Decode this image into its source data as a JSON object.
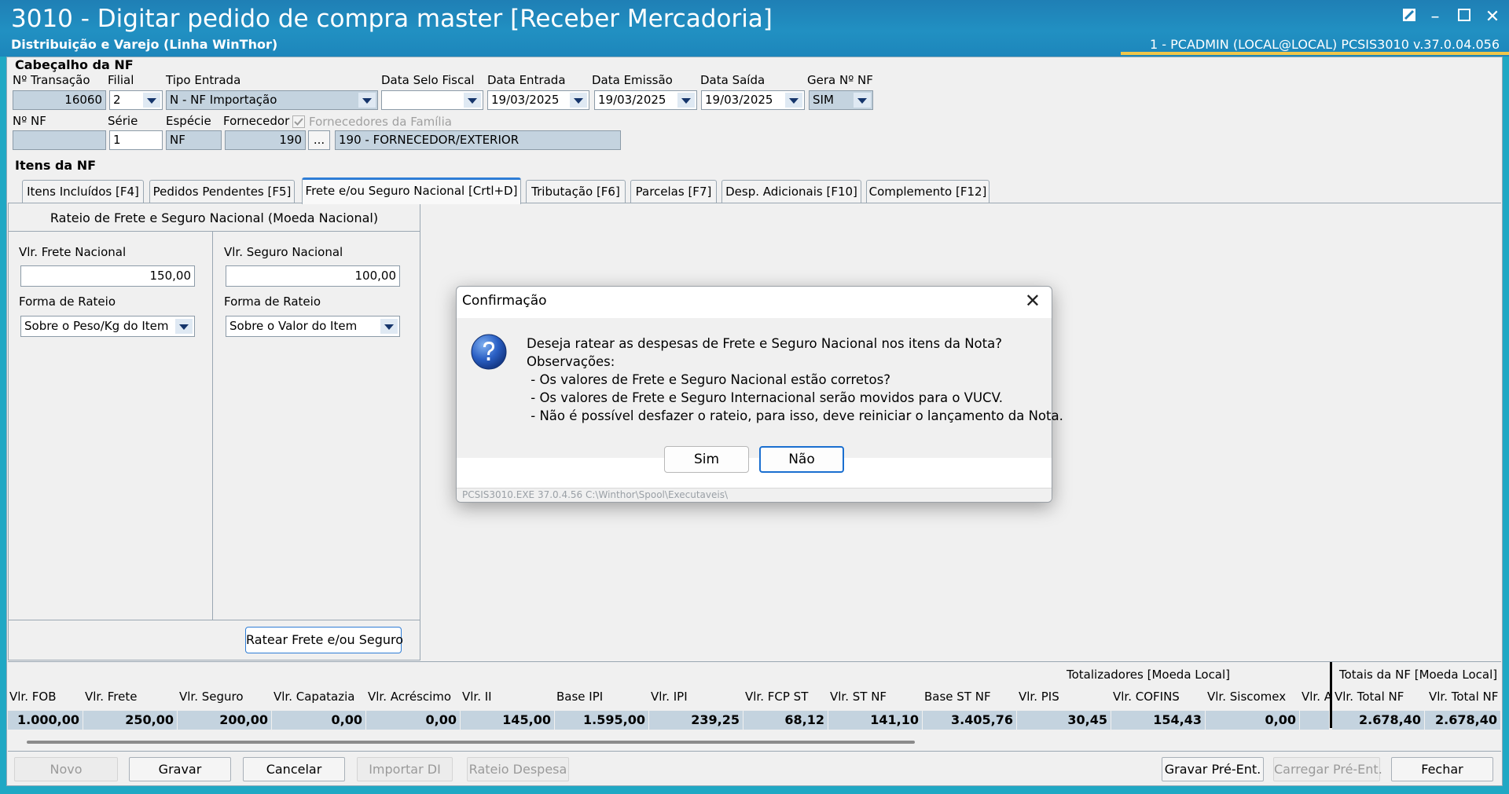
{
  "window": {
    "title": "3010 - Digitar pedido de compra master [Receber Mercadoria]",
    "subtitle": "Distribuição e Varejo (Linha WinThor)",
    "sysinfo": "1 - PCADMIN (LOCAL@LOCAL)   PCSIS3010  v.37.0.04.056"
  },
  "header_section": {
    "title": "Cabeçalho da NF",
    "fields": {
      "transacao": {
        "label": "Nº Transação",
        "value": "16060"
      },
      "filial": {
        "label": "Filial",
        "value": "2"
      },
      "tipo_entrada": {
        "label": "Tipo Entrada",
        "value": "N - NF Importação"
      },
      "data_selo": {
        "label": "Data Selo Fiscal",
        "value": ""
      },
      "data_entrada": {
        "label": "Data Entrada",
        "value": "19/03/2025"
      },
      "data_emissao": {
        "label": "Data Emissão",
        "value": "19/03/2025"
      },
      "data_saida": {
        "label": "Data Saída",
        "value": "19/03/2025"
      },
      "gera_nf": {
        "label": "Gera Nº NF",
        "value": "SIM"
      },
      "num_nf": {
        "label": "Nº NF",
        "value": ""
      },
      "serie": {
        "label": "Série",
        "value": "1"
      },
      "especie": {
        "label": "Espécie",
        "value": "NF"
      },
      "fornecedor": {
        "label": "Fornecedor",
        "value": "190"
      },
      "fornecedor_nome": {
        "value": "190 - FORNECEDOR/EXTERIOR"
      },
      "familia": {
        "label": "Fornecedores da Família",
        "checked": true
      },
      "browse": "..."
    }
  },
  "items_section": {
    "title": "Itens da NF",
    "tabs": [
      {
        "label": "Itens Incluídos [F4]",
        "active": false
      },
      {
        "label": "Pedidos Pendentes [F5]",
        "active": false
      },
      {
        "label": "Frete e/ou Seguro Nacional [Crtl+D]",
        "active": true
      },
      {
        "label": "Tributação [F6]",
        "active": false
      },
      {
        "label": "Parcelas [F7]",
        "active": false
      },
      {
        "label": "Desp. Adicionais [F10]",
        "active": false
      },
      {
        "label": "Complemento [F12]",
        "active": false
      }
    ]
  },
  "rateio": {
    "title": "Rateio de Frete e Seguro Nacional (Moeda Nacional)",
    "frete_label": "Vlr. Frete Nacional",
    "frete_value": "150,00",
    "frete_forma_label": "Forma de Rateio",
    "frete_forma_value": "Sobre o Peso/Kg do Item",
    "seguro_label": "Vlr. Seguro Nacional",
    "seguro_value": "100,00",
    "seguro_forma_label": "Forma de Rateio",
    "seguro_forma_value": "Sobre o Valor do Item",
    "button": "Ratear Frete e/ou Seguro"
  },
  "totals": {
    "group1": "Totalizadores [Moeda Local]",
    "group2": "Totais da NF [Moeda Local]",
    "columns": [
      {
        "label": "Vlr. FOB",
        "value": "1.000,00"
      },
      {
        "label": "Vlr. Frete",
        "value": "250,00"
      },
      {
        "label": "Vlr. Seguro",
        "value": "200,00"
      },
      {
        "label": "Vlr. Capatazia",
        "value": "0,00"
      },
      {
        "label": "Vlr. Acréscimo",
        "value": "0,00"
      },
      {
        "label": "Vlr. II",
        "value": "145,00"
      },
      {
        "label": "Base IPI",
        "value": "1.595,00"
      },
      {
        "label": "Vlr. IPI",
        "value": "239,25"
      },
      {
        "label": "Vlr. FCP ST",
        "value": "68,12"
      },
      {
        "label": "Vlr. ST NF",
        "value": "141,10"
      },
      {
        "label": "Base ST NF",
        "value": "3.405,76"
      },
      {
        "label": "Vlr. PIS",
        "value": "30,45"
      },
      {
        "label": "Vlr. COFINS",
        "value": "154,43"
      },
      {
        "label": "Vlr. Siscomex",
        "value": "0,00"
      },
      {
        "label": "Vlr. A",
        "value": ""
      },
      {
        "label": "Vlr. Total NF",
        "value": "2.678,40"
      },
      {
        "label": "Vlr. Total NF",
        "value": "2.678,40"
      }
    ]
  },
  "buttons": {
    "novo": "Novo",
    "gravar": "Gravar",
    "cancelar": "Cancelar",
    "importar": "Importar DI",
    "rateio": "Rateio Despesa",
    "gravar_pre": "Gravar Pré-Ent.",
    "carregar_pre": "Carregar Pré-Ent.",
    "fechar": "Fechar"
  },
  "dialog": {
    "title": "Confirmação",
    "message": "Deseja ratear as despesas de Frete e Seguro Nacional nos itens da Nota?\nObservações:\n - Os valores de Frete e Seguro Nacional estão corretos?\n - Os valores de Frete e Seguro Internacional serão movidos para o VUCV.\n - Não é possível desfazer o rateio, para isso, deve reiniciar o lançamento da Nota.",
    "yes": "Sim",
    "no": "Não",
    "footer": "PCSIS3010.EXE 37.0.4.56 C:\\Winthor\\Spool\\Executaveis\\"
  }
}
